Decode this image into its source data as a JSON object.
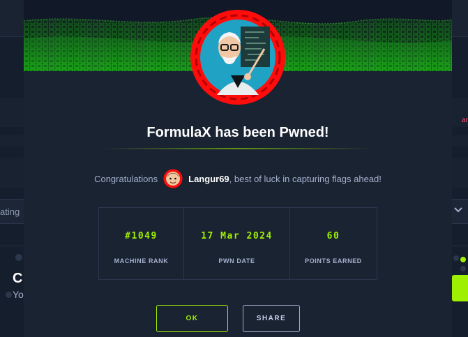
{
  "background": {
    "rating_label": "ating",
    "card_text": "ard",
    "big_text": "C",
    "small_text": "Yo"
  },
  "modal": {
    "title": "FormulaX has been Pwned!",
    "congrats_prefix": "Congratulations",
    "username": "Langur69",
    "congrats_suffix": ", best of luck in capturing flags ahead!",
    "stats": [
      {
        "value": "#1049",
        "label": "MACHINE RANK"
      },
      {
        "value": "17 Mar 2024",
        "label": "PWN DATE"
      },
      {
        "value": "60",
        "label": "POINTS EARNED"
      }
    ],
    "buttons": {
      "ok": "OK",
      "share": "SHARE"
    }
  },
  "colors": {
    "accent": "#9fef00",
    "background": "#141d2b",
    "modal": "#1a2332",
    "badge_ring": "#ff0d0d"
  },
  "icons": {
    "machine_avatar": "professor-avatar-icon",
    "user_avatar": "user-avatar-icon",
    "dropdown": "chevron-down-icon"
  }
}
